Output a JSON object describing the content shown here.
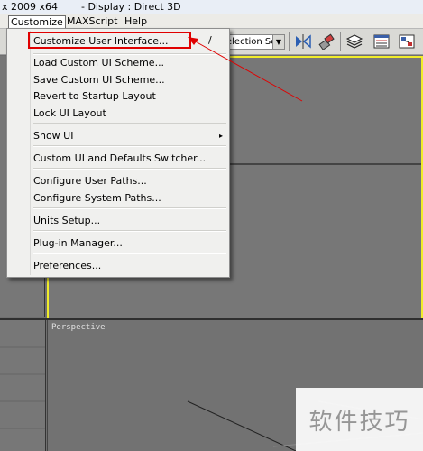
{
  "window": {
    "title_left": "x  2009 x64",
    "title_right": "- Display : Direct 3D"
  },
  "menubar": {
    "items": [
      {
        "label": "Customize",
        "active": true
      },
      {
        "label": "MAXScript",
        "active": false
      },
      {
        "label": "Help",
        "active": false
      }
    ]
  },
  "toolbar": {
    "selection_set_value": "election Set",
    "icons": [
      "mirror-icon",
      "align-icon",
      "layer-manager-icon",
      "curve-editor-icon",
      "schematic-view-icon"
    ]
  },
  "customize_menu": {
    "items": [
      "Customize User Interface...",
      "Load Custom UI Scheme...",
      "Save Custom UI Scheme...",
      "Revert to Startup Layout",
      "Lock UI Layout",
      "Show UI",
      "Custom UI and Defaults Switcher...",
      "Configure User Paths...",
      "Configure System Paths...",
      "Units Setup...",
      "Plug-in Manager...",
      "Preferences..."
    ],
    "submenu_arrow": "▸",
    "slash_text": "/"
  },
  "viewports": {
    "perspective_label": "Perspective",
    "gizmo_x": "x"
  },
  "watermark": {
    "text": "软件技巧"
  },
  "colors": {
    "active_viewport_border": "#f0ec2a",
    "annotation": "#e00000"
  }
}
